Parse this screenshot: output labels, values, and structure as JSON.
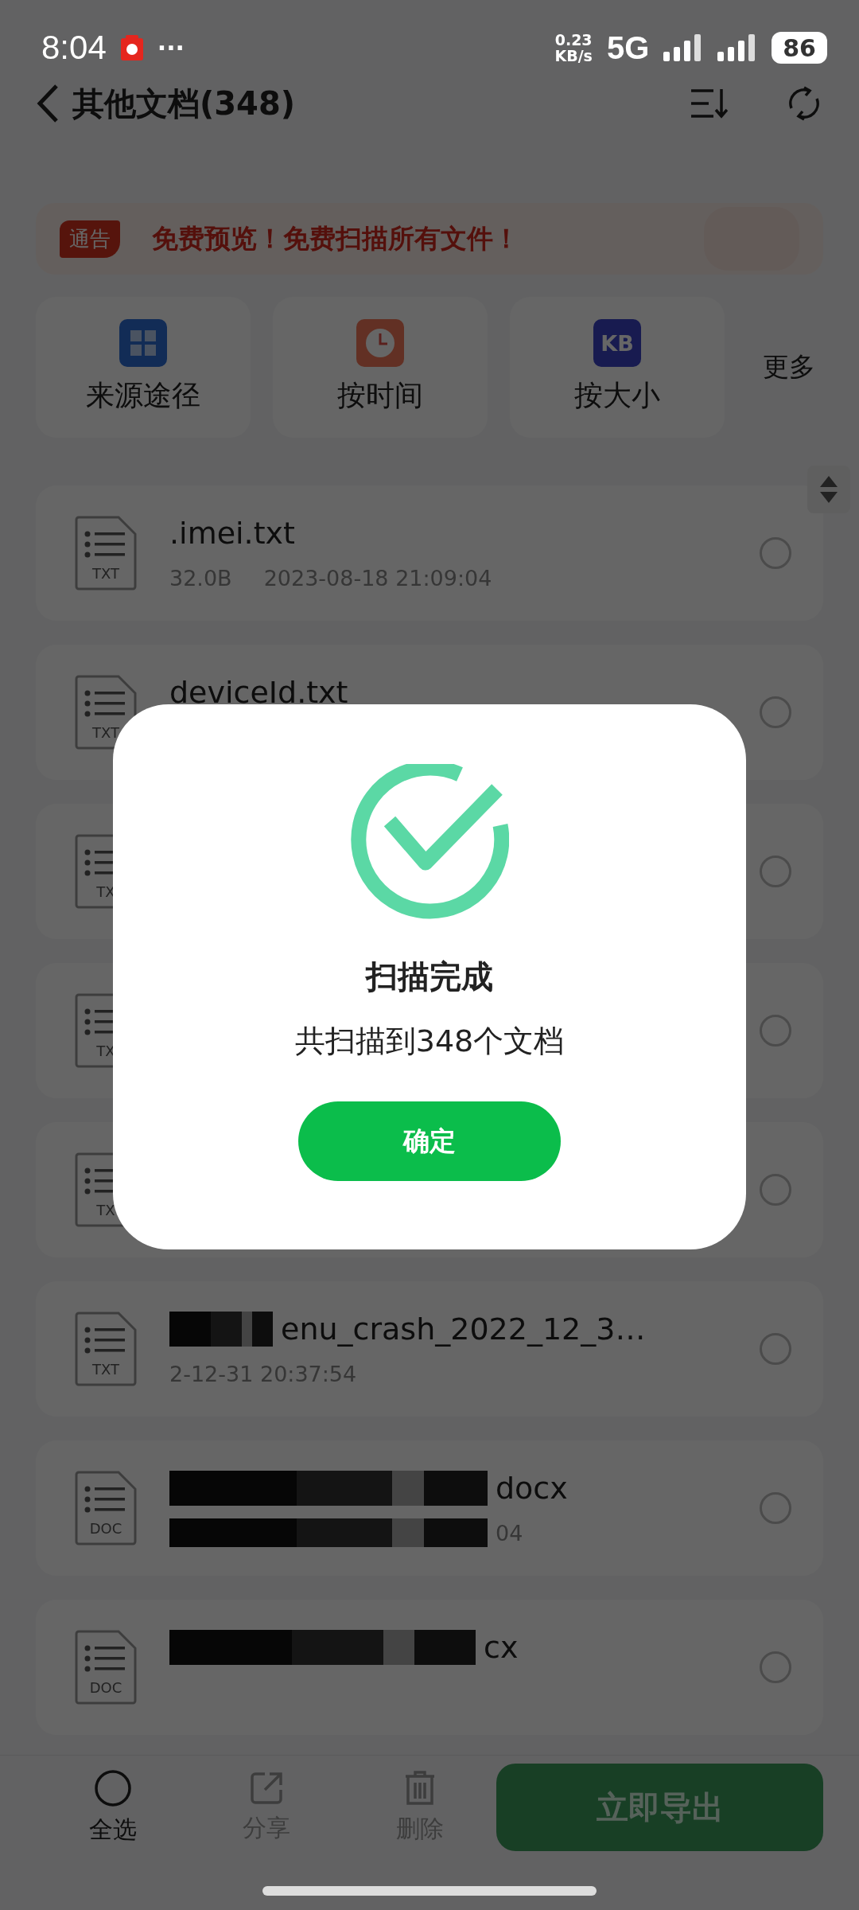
{
  "status_bar": {
    "time": "8:04",
    "more": "···",
    "speed_value": "0.23",
    "speed_unit": "KB/s",
    "network": "5G",
    "battery": "86"
  },
  "header": {
    "title": "其他文档(348)"
  },
  "notice": {
    "badge": "通告",
    "text": "免费预览！免费扫描所有文件！"
  },
  "filters": [
    {
      "label": "来源途径"
    },
    {
      "label": "按时间"
    },
    {
      "label": "按大小",
      "icon_text": "KB"
    }
  ],
  "more": "更多",
  "files": [
    {
      "type": "TXT",
      "name": ".imei.txt",
      "size": "32.0B",
      "date": "2023-08-18 21:09:04",
      "selected": false
    },
    {
      "type": "TXT",
      "name": "deviceId.txt",
      "selected": false
    },
    {
      "type": "TX",
      "selected": false
    },
    {
      "type": "TX",
      "selected": false
    },
    {
      "type": "TX",
      "selected": false
    },
    {
      "type": "TXT",
      "name": "enu_crash_2022_12_3…",
      "date": "2-12-31 20:37:54",
      "redacted": true,
      "selected": false
    },
    {
      "type": "DOC",
      "name": "docx",
      "date": "04",
      "redacted": true,
      "selected": false
    },
    {
      "type": "DOC",
      "name": "cx",
      "redacted": true,
      "selected": false
    }
  ],
  "toolbar": [
    {
      "label": "全选",
      "disabled": false
    },
    {
      "label": "分享",
      "disabled": true
    },
    {
      "label": "删除",
      "disabled": true
    }
  ],
  "export_button": {
    "label": "立即导出",
    "disabled": true
  },
  "dialog": {
    "title": "扫描完成",
    "message": "共扫描到348个文档",
    "button": "确定"
  }
}
